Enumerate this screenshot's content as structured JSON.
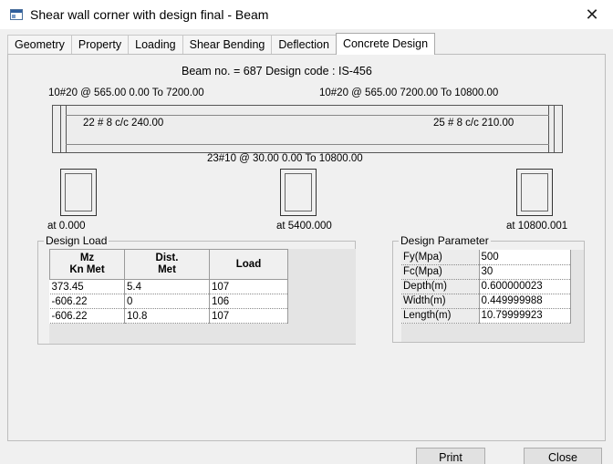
{
  "window": {
    "title": "Shear wall corner with design final - Beam",
    "close_symbol": "✕",
    "icon": "beam-window-icon"
  },
  "tabs": [
    {
      "label": "Geometry",
      "active": false
    },
    {
      "label": "Property",
      "active": false
    },
    {
      "label": "Loading",
      "active": false
    },
    {
      "label": "Shear Bending",
      "active": false
    },
    {
      "label": "Deflection",
      "active": false
    },
    {
      "label": "Concrete Design",
      "active": true
    }
  ],
  "design": {
    "header": "Beam no. = 687  Design code :  IS-456",
    "top_rebar_left": "10#20 @ 565.00 0.00 To 7200.00",
    "top_rebar_right": "10#20 @ 565.00 7200.00 To 10800.00",
    "stirrup_left": "22 # 8 c/c 240.00",
    "stirrup_right": "25 # 8 c/c 210.00",
    "bottom_rebar": "23#10 @ 30.00 0.00 To 10800.00",
    "sections": [
      {
        "label": "at 0.000"
      },
      {
        "label": "at 5400.000"
      },
      {
        "label": "at 10800.001"
      }
    ]
  },
  "design_load": {
    "title": "Design Load",
    "headers": [
      "Mz\nKn Met",
      "Dist.\nMet",
      "Load"
    ],
    "rows": [
      [
        "373.45",
        "5.4",
        "107"
      ],
      [
        "-606.22",
        "0",
        "106"
      ],
      [
        "-606.22",
        "10.8",
        "107"
      ]
    ]
  },
  "design_parameter": {
    "title": "Design Parameter",
    "rows": [
      [
        "Fy(Mpa)",
        "500"
      ],
      [
        "Fc(Mpa)",
        "30"
      ],
      [
        "Depth(m)",
        "0.600000023"
      ],
      [
        "Width(m)",
        "0.449999988"
      ],
      [
        "Length(m)",
        "10.79999923"
      ]
    ]
  },
  "buttons": {
    "print": "Print",
    "close": "Close"
  },
  "colors": {
    "window_bg": "#ffffff",
    "panel_bg": "#f0f0f0",
    "beam_outline": "#555555",
    "grid_fill": "#e4e4e4"
  }
}
